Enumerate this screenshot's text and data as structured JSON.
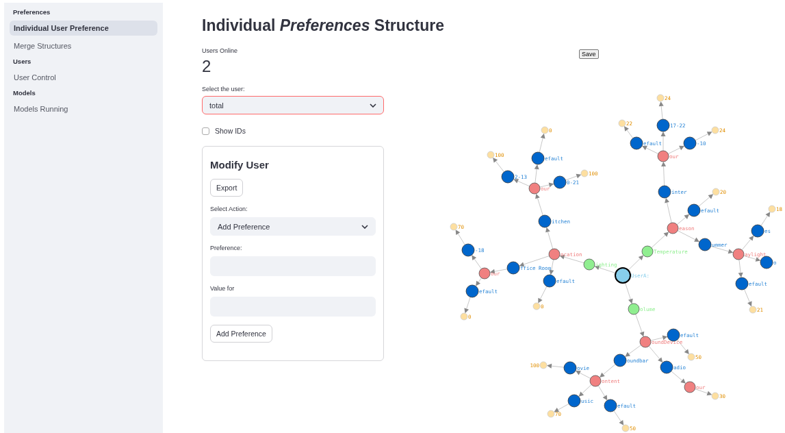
{
  "sidebar": {
    "sections": [
      {
        "heading": "Preferences",
        "items": [
          {
            "label": "Individual User Preference",
            "selected": true
          },
          {
            "label": "Merge Structures",
            "selected": false
          }
        ]
      },
      {
        "heading": "Users",
        "items": [
          {
            "label": "User Control",
            "selected": false
          }
        ]
      },
      {
        "heading": "Models",
        "items": [
          {
            "label": "Models Running",
            "selected": false
          }
        ]
      }
    ]
  },
  "page": {
    "title": "Individual *Preferences* Structure",
    "users_online": {
      "label": "Users Online",
      "value": "2"
    },
    "user_select": {
      "label": "Select the user:",
      "value": "total",
      "focused": true
    },
    "show_ids": {
      "label": "Show IDs",
      "checked": false
    },
    "save_button": "Save"
  },
  "modify_user": {
    "title": "Modify User",
    "export_button": "Export",
    "action": {
      "label": "Select Action:",
      "value": "Add Preference"
    },
    "preference": {
      "label": "Preference:"
    },
    "value_for": {
      "label": "Value for"
    },
    "submit_button": "Add Preference"
  },
  "graph": {
    "root": {
      "kind": "user",
      "label": "UserA:",
      "children": [
        {
          "kind": "category",
          "label": "ighting",
          "children": [
            {
              "kind": "attribute",
              "label": "ocation",
              "children": [
                {
                  "kind": "option",
                  "label": "itchen",
                  "children": [
                    {
                      "kind": "attribute",
                      "label": "our",
                      "children": [
                        {
                          "kind": "option",
                          "label": "2-13",
                          "children": [
                            {
                              "kind": "value",
                              "label": "100"
                            }
                          ]
                        },
                        {
                          "kind": "option",
                          "label": "efault",
                          "children": [
                            {
                              "kind": "value",
                              "label": "0"
                            }
                          ]
                        },
                        {
                          "kind": "option",
                          "label": "0-21",
                          "children": [
                            {
                              "kind": "value",
                              "label": "100"
                            }
                          ]
                        }
                      ]
                    }
                  ]
                },
                {
                  "kind": "option",
                  "label": "ffice Room",
                  "children": [
                    {
                      "kind": "attribute",
                      "label": "our",
                      "children": [
                        {
                          "kind": "option",
                          "label": "-18",
                          "children": [
                            {
                              "kind": "value",
                              "label": "70"
                            }
                          ]
                        },
                        {
                          "kind": "option",
                          "label": "efault",
                          "children": [
                            {
                              "kind": "value",
                              "label": "0"
                            }
                          ]
                        }
                      ]
                    }
                  ]
                },
                {
                  "kind": "option",
                  "label": "efault",
                  "children": [
                    {
                      "kind": "value",
                      "label": "0"
                    }
                  ]
                }
              ]
            }
          ]
        },
        {
          "kind": "category",
          "label": "Temperature",
          "children": [
            {
              "kind": "attribute",
              "label": "eason",
              "children": [
                {
                  "kind": "option",
                  "label": "inter",
                  "children": [
                    {
                      "kind": "attribute",
                      "label": "our",
                      "children": [
                        {
                          "kind": "option",
                          "label": "efault",
                          "children": [
                            {
                              "kind": "value",
                              "label": "22"
                            }
                          ]
                        },
                        {
                          "kind": "option",
                          "label": "17-22",
                          "children": [
                            {
                              "kind": "value",
                              "label": "24"
                            }
                          ]
                        },
                        {
                          "kind": "option",
                          "label": "-10",
                          "children": [
                            {
                              "kind": "value",
                              "label": "24"
                            }
                          ]
                        }
                      ]
                    }
                  ]
                },
                {
                  "kind": "option",
                  "label": "efault",
                  "children": [
                    {
                      "kind": "value",
                      "label": "20"
                    }
                  ]
                },
                {
                  "kind": "option",
                  "label": "ummer",
                  "children": [
                    {
                      "kind": "attribute",
                      "label": "aylight",
                      "children": [
                        {
                          "kind": "option",
                          "label": "es",
                          "children": [
                            {
                              "kind": "value",
                              "label": "18"
                            }
                          ]
                        },
                        {
                          "kind": "option",
                          "label": "o"
                        },
                        {
                          "kind": "option",
                          "label": "efault",
                          "children": [
                            {
                              "kind": "value",
                              "label": "21"
                            }
                          ]
                        }
                      ]
                    }
                  ]
                }
              ]
            }
          ]
        },
        {
          "kind": "category",
          "label": "olume",
          "children": [
            {
              "kind": "attribute",
              "label": "oundDevice",
              "children": [
                {
                  "kind": "option",
                  "label": "efault",
                  "children": [
                    {
                      "kind": "value",
                      "label": "50"
                    }
                  ]
                },
                {
                  "kind": "option",
                  "label": "oundbar",
                  "children": [
                    {
                      "kind": "attribute",
                      "label": "ontent",
                      "children": [
                        {
                          "kind": "option",
                          "label": "ovie",
                          "children": [
                            {
                              "kind": "value",
                              "label": "100"
                            }
                          ]
                        },
                        {
                          "kind": "option",
                          "label": "usic",
                          "children": [
                            {
                              "kind": "value",
                              "label": "70"
                            }
                          ]
                        },
                        {
                          "kind": "option",
                          "label": "efault",
                          "children": [
                            {
                              "kind": "value",
                              "label": "50"
                            }
                          ]
                        }
                      ]
                    }
                  ]
                },
                {
                  "kind": "option",
                  "label": "adio",
                  "children": [
                    {
                      "kind": "attribute",
                      "label": "our",
                      "children": [
                        {
                          "kind": "value",
                          "label": "30"
                        }
                      ]
                    }
                  ]
                }
              ]
            }
          ]
        }
      ]
    }
  }
}
